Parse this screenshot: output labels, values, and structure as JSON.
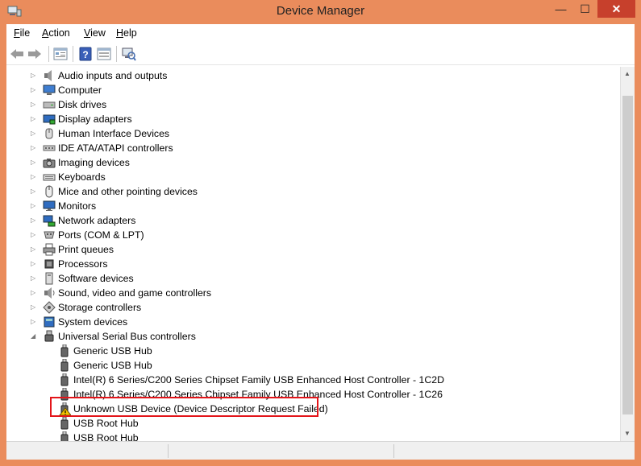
{
  "window": {
    "title": "Device Manager",
    "minimize_glyph": "—",
    "maximize_glyph": "☐",
    "close_glyph": "✕"
  },
  "menu": [
    {
      "key": "F",
      "rest": "ile"
    },
    {
      "key": "A",
      "rest": "ction"
    },
    {
      "key": "V",
      "rest": "iew"
    },
    {
      "key": "H",
      "rest": "elp"
    }
  ],
  "toolbar": [
    "back-icon",
    "forward-icon",
    "properties-icon",
    "help-icon",
    "show-hidden-icon",
    "scan-hardware-icon"
  ],
  "tree": {
    "categories": [
      {
        "label": "Audio inputs and outputs",
        "icon": "speaker-icon"
      },
      {
        "label": "Computer",
        "icon": "computer-icon"
      },
      {
        "label": "Disk drives",
        "icon": "disk-drive-icon"
      },
      {
        "label": "Display adapters",
        "icon": "display-adapter-icon"
      },
      {
        "label": "Human Interface Devices",
        "icon": "hid-icon"
      },
      {
        "label": "IDE ATA/ATAPI controllers",
        "icon": "ide-controller-icon"
      },
      {
        "label": "Imaging devices",
        "icon": "camera-icon"
      },
      {
        "label": "Keyboards",
        "icon": "keyboard-icon"
      },
      {
        "label": "Mice and other pointing devices",
        "icon": "mouse-icon"
      },
      {
        "label": "Monitors",
        "icon": "monitor-icon"
      },
      {
        "label": "Network adapters",
        "icon": "network-adapter-icon"
      },
      {
        "label": "Ports (COM & LPT)",
        "icon": "port-icon"
      },
      {
        "label": "Print queues",
        "icon": "printer-icon"
      },
      {
        "label": "Processors",
        "icon": "processor-icon"
      },
      {
        "label": "Software devices",
        "icon": "software-device-icon"
      },
      {
        "label": "Sound, video and game controllers",
        "icon": "sound-icon"
      },
      {
        "label": "Storage controllers",
        "icon": "storage-controller-icon"
      },
      {
        "label": "System devices",
        "icon": "system-device-icon"
      },
      {
        "label": "Universal Serial Bus controllers",
        "icon": "usb-icon",
        "expanded": true
      }
    ],
    "usb_children": [
      {
        "label": "Generic USB Hub",
        "icon": "usb-plug-icon"
      },
      {
        "label": "Generic USB Hub",
        "icon": "usb-plug-icon"
      },
      {
        "label": "Intel(R) 6 Series/C200 Series Chipset Family USB Enhanced Host Controller - 1C2D",
        "icon": "usb-plug-icon"
      },
      {
        "label": "Intel(R) 6 Series/C200 Series Chipset Family USB Enhanced Host Controller - 1C26",
        "icon": "usb-plug-icon"
      },
      {
        "label": "Unknown USB Device (Device Descriptor Request Failed)",
        "icon": "usb-warning-icon",
        "warning": true
      },
      {
        "label": "USB Root Hub",
        "icon": "usb-plug-icon"
      },
      {
        "label": "USB Root Hub",
        "icon": "usb-plug-icon"
      }
    ]
  },
  "colors": {
    "titlebar": "#ea8c5c",
    "close_button": "#c7402c",
    "highlight": "#e3151a"
  }
}
